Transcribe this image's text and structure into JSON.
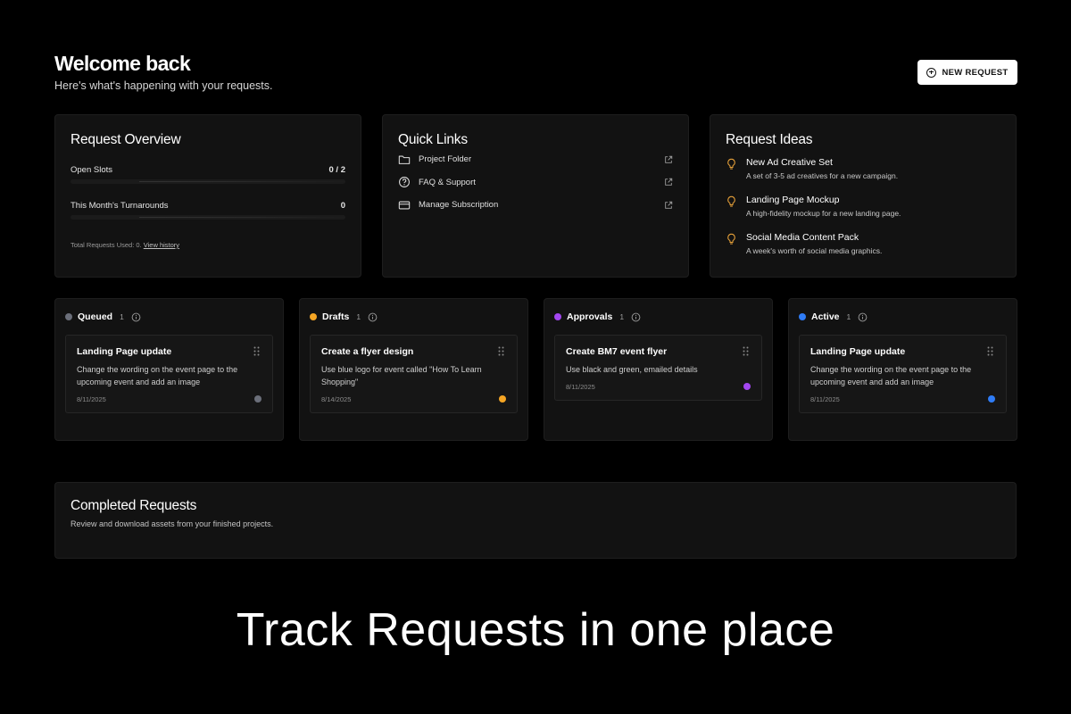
{
  "header": {
    "title": "Welcome back",
    "subtitle": "Here's what's happening with your requests.",
    "new_request_label": "NEW REQUEST"
  },
  "overview": {
    "title": "Request Overview",
    "open_slots_label": "Open Slots",
    "open_slots_value": "0 / 2",
    "open_slots_fraction": 0,
    "turnarounds_label": "This Month's Turnarounds",
    "turnarounds_value": "0",
    "footer_text": "Total Requests Used: 0.",
    "footer_link": "View history"
  },
  "quick_links": {
    "title": "Quick Links",
    "items": [
      {
        "label": "Project Folder",
        "icon": "folder-icon"
      },
      {
        "label": "FAQ & Support",
        "icon": "help-circle-icon"
      },
      {
        "label": "Manage Subscription",
        "icon": "credit-card-icon"
      }
    ]
  },
  "ideas": {
    "title": "Request Ideas",
    "items": [
      {
        "title": "New Ad Creative Set",
        "desc": "A set of 3-5 ad creatives for a new campaign."
      },
      {
        "title": "Landing Page Mockup",
        "desc": "A high-fidelity mockup for a new landing page."
      },
      {
        "title": "Social Media Content Pack",
        "desc": "A week's worth of social media graphics."
      }
    ]
  },
  "columns": [
    {
      "name": "Queued",
      "count": "1",
      "color": "#6b6f7a",
      "task": {
        "title": "Landing Page update",
        "desc": "Change the wording on the event page to the upcoming event and add an image",
        "date": "8/11/2025",
        "color": "#6b6f7a"
      }
    },
    {
      "name": "Drafts",
      "count": "1",
      "color": "#f5a524",
      "task": {
        "title": "Create a flyer design",
        "desc": "Use blue logo for event called \"How To Learn Shopping\"",
        "date": "8/14/2025",
        "color": "#f5a524"
      }
    },
    {
      "name": "Approvals",
      "count": "1",
      "color": "#a347f0",
      "task": {
        "title": "Create BM7 event flyer",
        "desc": "Use black and green, emailed details",
        "date": "8/11/2025",
        "color": "#a347f0"
      }
    },
    {
      "name": "Active",
      "count": "1",
      "color": "#2f7cf6",
      "task": {
        "title": "Landing Page update",
        "desc": "Change the wording on the event page to the upcoming event and add an image",
        "date": "8/11/2025",
        "color": "#2f7cf6"
      }
    }
  ],
  "completed": {
    "title": "Completed Requests",
    "subtitle": "Review and download assets from your finished projects."
  },
  "tagline": "Track Requests in one place",
  "colors": {
    "background": "#000000",
    "card": "#121212",
    "idea_icon": "#e8a23a"
  }
}
